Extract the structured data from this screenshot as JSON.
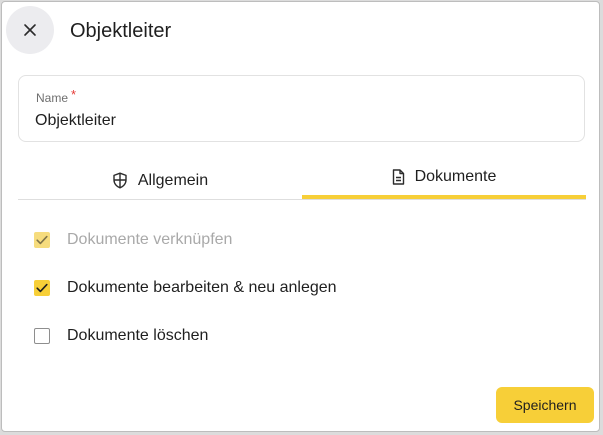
{
  "dialog": {
    "title": "Objektleiter",
    "close_icon": "close-icon"
  },
  "name_field": {
    "label": "Name",
    "required_marker": "*",
    "value": "Objektleiter"
  },
  "tabs": [
    {
      "label": "Allgemein",
      "icon": "shield-icon",
      "active": false
    },
    {
      "label": "Dokumente",
      "icon": "document-icon",
      "active": true
    }
  ],
  "options": [
    {
      "label": "Dokumente verknüpfen",
      "checked": true,
      "disabled": true
    },
    {
      "label": "Dokumente bearbeiten & neu anlegen",
      "checked": true,
      "disabled": false
    },
    {
      "label": "Dokumente löschen",
      "checked": false,
      "disabled": false
    }
  ],
  "actions": {
    "save_label": "Speichern"
  },
  "colors": {
    "accent": "#f7cf38",
    "required": "#e53935"
  }
}
